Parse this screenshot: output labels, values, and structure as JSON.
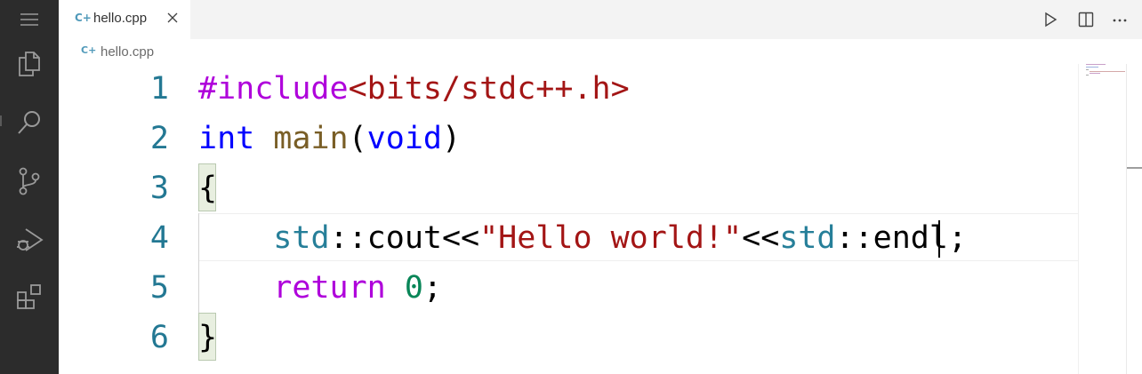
{
  "tab": {
    "label": "hello.cpp",
    "icon": "C+"
  },
  "breadcrumb": {
    "label": "hello.cpp",
    "icon": "C+"
  },
  "editor": {
    "lines": [
      {
        "num": "1"
      },
      {
        "num": "2"
      },
      {
        "num": "3"
      },
      {
        "num": "4"
      },
      {
        "num": "5"
      },
      {
        "num": "6"
      }
    ],
    "tokens": {
      "l1_include": "#include",
      "l1_header": "<bits/stdc++.h>",
      "l2_int": "int",
      "l2_main": "main",
      "l2_lparen": "(",
      "l2_void": "void",
      "l2_rparen": ")",
      "l3_brace": "{",
      "l4_indent": "    ",
      "l4_std1": "std",
      "l4_sep1": "::",
      "l4_cout": "cout<<",
      "l4_str": "\"Hello world!\"",
      "l4_shift": "<<",
      "l4_std2": "std",
      "l4_sep2": "::",
      "l4_endl": "endl;",
      "l5_indent": "    ",
      "l5_return": "return",
      "l5_space": " ",
      "l5_zero": "0",
      "l5_semi": ";",
      "l6_brace": "}"
    }
  },
  "colors": {
    "activity_bar": "#2c2c2c",
    "line_number": "#237893",
    "directive": "#af00db",
    "string": "#a31515",
    "keyword": "#0000ff",
    "function": "#795e26",
    "namespace": "#267f99",
    "number": "#098658"
  },
  "icons": {
    "menu": "menu-icon",
    "explorer": "files-icon",
    "search": "search-icon",
    "scm": "source-control-icon",
    "debug": "run-debug-icon",
    "extensions": "extensions-icon",
    "close": "close-icon",
    "run": "play-icon",
    "split": "split-editor-icon",
    "more": "more-icon"
  }
}
